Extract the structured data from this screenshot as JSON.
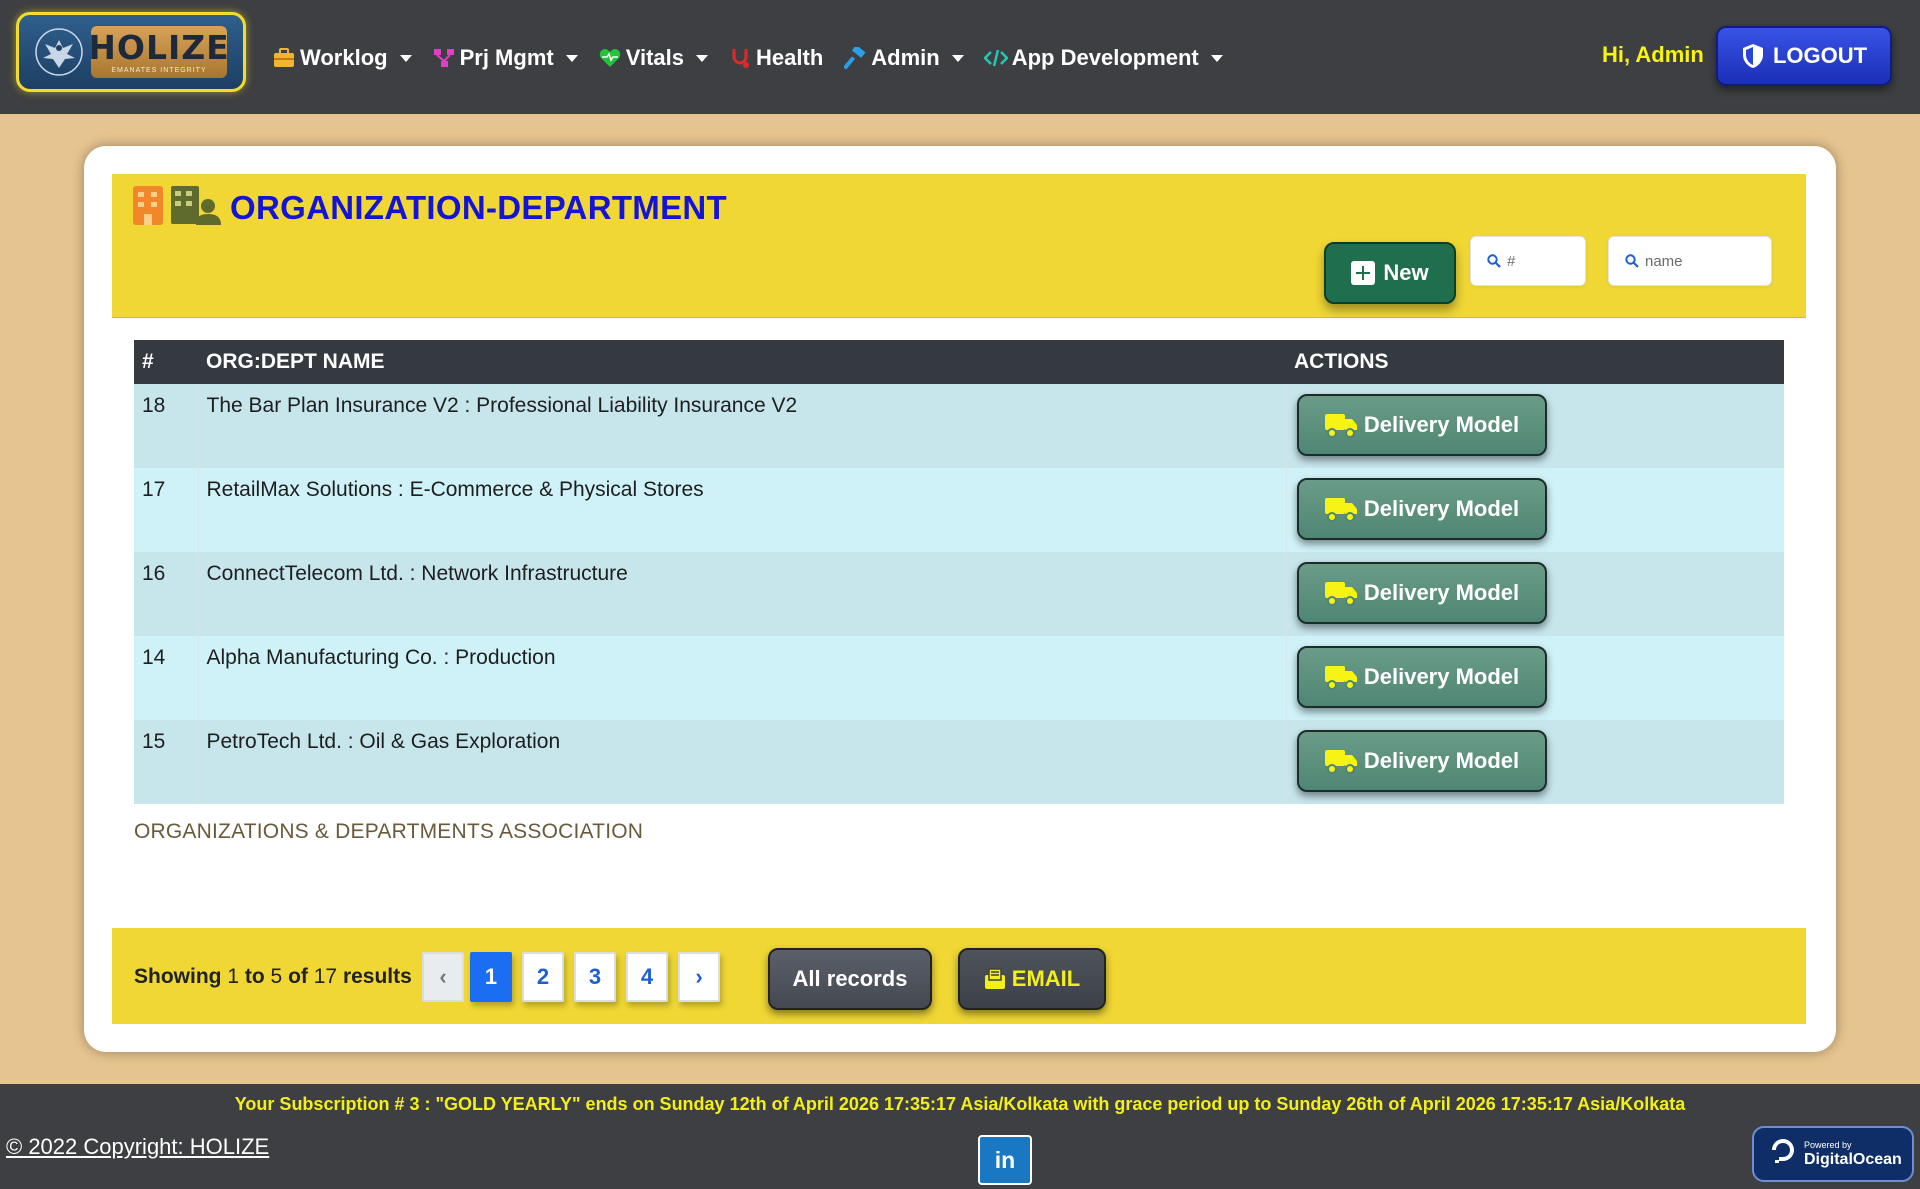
{
  "brand": {
    "name": "HOLIZE",
    "tagline": "EMANATES INTEGRITY"
  },
  "nav": {
    "items": [
      {
        "label": "Worklog",
        "icon": "briefcase-icon",
        "dropdown": true,
        "color": "#f2b431"
      },
      {
        "label": "Prj Mgmt",
        "icon": "project-tree-icon",
        "dropdown": true,
        "color": "#e23fc6"
      },
      {
        "label": "Vitals",
        "icon": "heart-pulse-icon",
        "dropdown": true,
        "color": "#23c43a"
      },
      {
        "label": "Health",
        "icon": "health-icon",
        "dropdown": false,
        "color": "#e02a2a"
      },
      {
        "label": "Admin",
        "icon": "hammer-icon",
        "dropdown": true,
        "color": "#2aa0e8"
      },
      {
        "label": "App Development",
        "icon": "code-icon",
        "dropdown": true,
        "color": "#25c7b1"
      }
    ],
    "greeting": "Hi, Admin",
    "logout_label": "LOGOUT"
  },
  "page": {
    "title": "ORGANIZATION-DEPARTMENT",
    "new_label": "New",
    "search_id_placeholder": "#",
    "search_name_placeholder": "name"
  },
  "table": {
    "headers": {
      "id": "#",
      "name": "ORG:DEPT NAME",
      "actions": "ACTIONS"
    },
    "action_label": "Delivery Model",
    "rows": [
      {
        "id": "18",
        "name": "The Bar Plan Insurance V2 : Professional Liability Insurance V2"
      },
      {
        "id": "17",
        "name": "RetailMax Solutions : E-Commerce & Physical Stores"
      },
      {
        "id": "16",
        "name": "ConnectTelecom Ltd. : Network Infrastructure"
      },
      {
        "id": "14",
        "name": "Alpha Manufacturing Co. : Production"
      },
      {
        "id": "15",
        "name": "PetroTech Ltd. : Oil & Gas Exploration"
      }
    ]
  },
  "association_label": "ORGANIZATIONS & DEPARTMENTS ASSOCIATION",
  "pagination": {
    "showing_word": "Showing",
    "from": "1",
    "to_word": "to",
    "to": "5",
    "of_word": "of",
    "total": "17",
    "results_word": "results",
    "prev": "‹",
    "next": "›",
    "pages": [
      "1",
      "2",
      "3",
      "4"
    ],
    "current": "1",
    "all_records_label": "All records",
    "email_label": "EMAIL"
  },
  "footer": {
    "subscription": "Your Subscription # 3 : \"GOLD YEARLY\" ends on Sunday 12th of April 2026 17:35:17 Asia/Kolkata with grace period up to Sunday 26th of April 2026 17:35:17 Asia/Kolkata",
    "copyright": "© 2022 Copyright: HOLIZE",
    "linkedin_label": "in",
    "powered_by": "Powered by",
    "provider": "DigitalOcean"
  },
  "colors": {
    "navbar": "#3e3f42",
    "page_bg": "#e6c48f",
    "band": "#f0d734",
    "title": "#1414d6",
    "greeting": "#f7f312",
    "logout": "#2a45d6",
    "new_button": "#1f6f4f",
    "action_button": "#5d917d",
    "page_active": "#1b6df2"
  }
}
